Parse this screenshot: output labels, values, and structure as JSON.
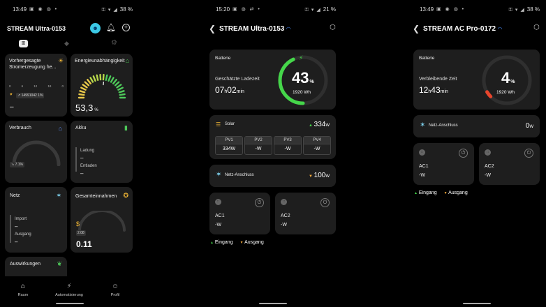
{
  "p1": {
    "status": {
      "time": "13:49",
      "icons": "▣ ◉ ◍ •",
      "sys": "⚿ ▾ ◢",
      "battery": "38 %"
    },
    "title": "STREAM Ultra-0153",
    "cards": {
      "forecast": {
        "title": "Vorhergesagte Stromerzeugung he...",
        "scale": [
          "0",
          "6",
          "12",
          "18",
          "0"
        ],
        "tag": "↗ 14991042 1%",
        "value": "–"
      },
      "autarky": {
        "title": "Energieunabhängigkeit",
        "value": "53,3",
        "unit": "%"
      },
      "consumption": {
        "title": "Verbrauch",
        "tag": "↘ 7.1%"
      },
      "battery": {
        "title": "Akku",
        "charging": "Ladung",
        "charging_value": "–",
        "discharging": "Entladen",
        "discharging_value": "–"
      },
      "grid": {
        "title": "Netz",
        "import": "Import",
        "import_value": "–",
        "export": "Ausgang",
        "export_value": "–"
      },
      "income": {
        "title": "Gesamteinnahmen",
        "tag": "2.08",
        "value": "0.11"
      },
      "impact": {
        "title": "Auswirkungen"
      }
    },
    "nav": [
      {
        "label": "Raum"
      },
      {
        "label": "Automatisierung"
      },
      {
        "label": "Profil"
      }
    ]
  },
  "p2": {
    "status": {
      "time": "15:20",
      "icons": "▣ ◍ ⇄ •",
      "sys": "⚿ ▾ ◢",
      "battery": "21 %"
    },
    "title": "STREAM Ultra-0153",
    "battery_card": {
      "label": "Batterie",
      "estimate_label": "Geschätzte Ladezeit",
      "hours": "07",
      "h_unit": "h",
      "minutes": "02",
      "min_unit": "min",
      "percent": "43",
      "pct_unit": "%",
      "capacity": "1920 Wh",
      "level": 0.43
    },
    "solar": {
      "label": "Solar",
      "value": "334",
      "unit": "W",
      "panels": [
        {
          "name": "PV1",
          "value": "334W"
        },
        {
          "name": "PV2",
          "value": "-W"
        },
        {
          "name": "PV3",
          "value": "-W"
        },
        {
          "name": "PV4",
          "value": "-W"
        }
      ]
    },
    "grid": {
      "label": "Netz-Anschluss",
      "value": "100",
      "unit": "W"
    },
    "ac1": {
      "label": "AC1",
      "value": "-W"
    },
    "ac2": {
      "label": "AC2",
      "value": "-W"
    },
    "legend": {
      "input": "Eingang",
      "output": "Ausgang"
    }
  },
  "p3": {
    "status": {
      "time": "13:49",
      "icons": "▣ ◉ ◍ •",
      "sys": "⚿ ▾ ◢",
      "battery": "38 %"
    },
    "title": "STREAM AC Pro-0172",
    "battery_card": {
      "label": "Batterie",
      "remaining_label": "Verbleibende Zeit",
      "hours": "12",
      "h_unit": "h",
      "minutes": "43",
      "min_unit": "min",
      "percent": "4",
      "pct_unit": "%",
      "capacity": "1920 Wh",
      "level": 0.04
    },
    "grid": {
      "label": "Netz-Anschluss",
      "value": "0",
      "unit": "W"
    },
    "ac1": {
      "label": "AC1",
      "value": "-W"
    },
    "ac2": {
      "label": "AC2",
      "value": "-W"
    },
    "legend": {
      "input": "Eingang",
      "output": "Ausgang"
    }
  }
}
